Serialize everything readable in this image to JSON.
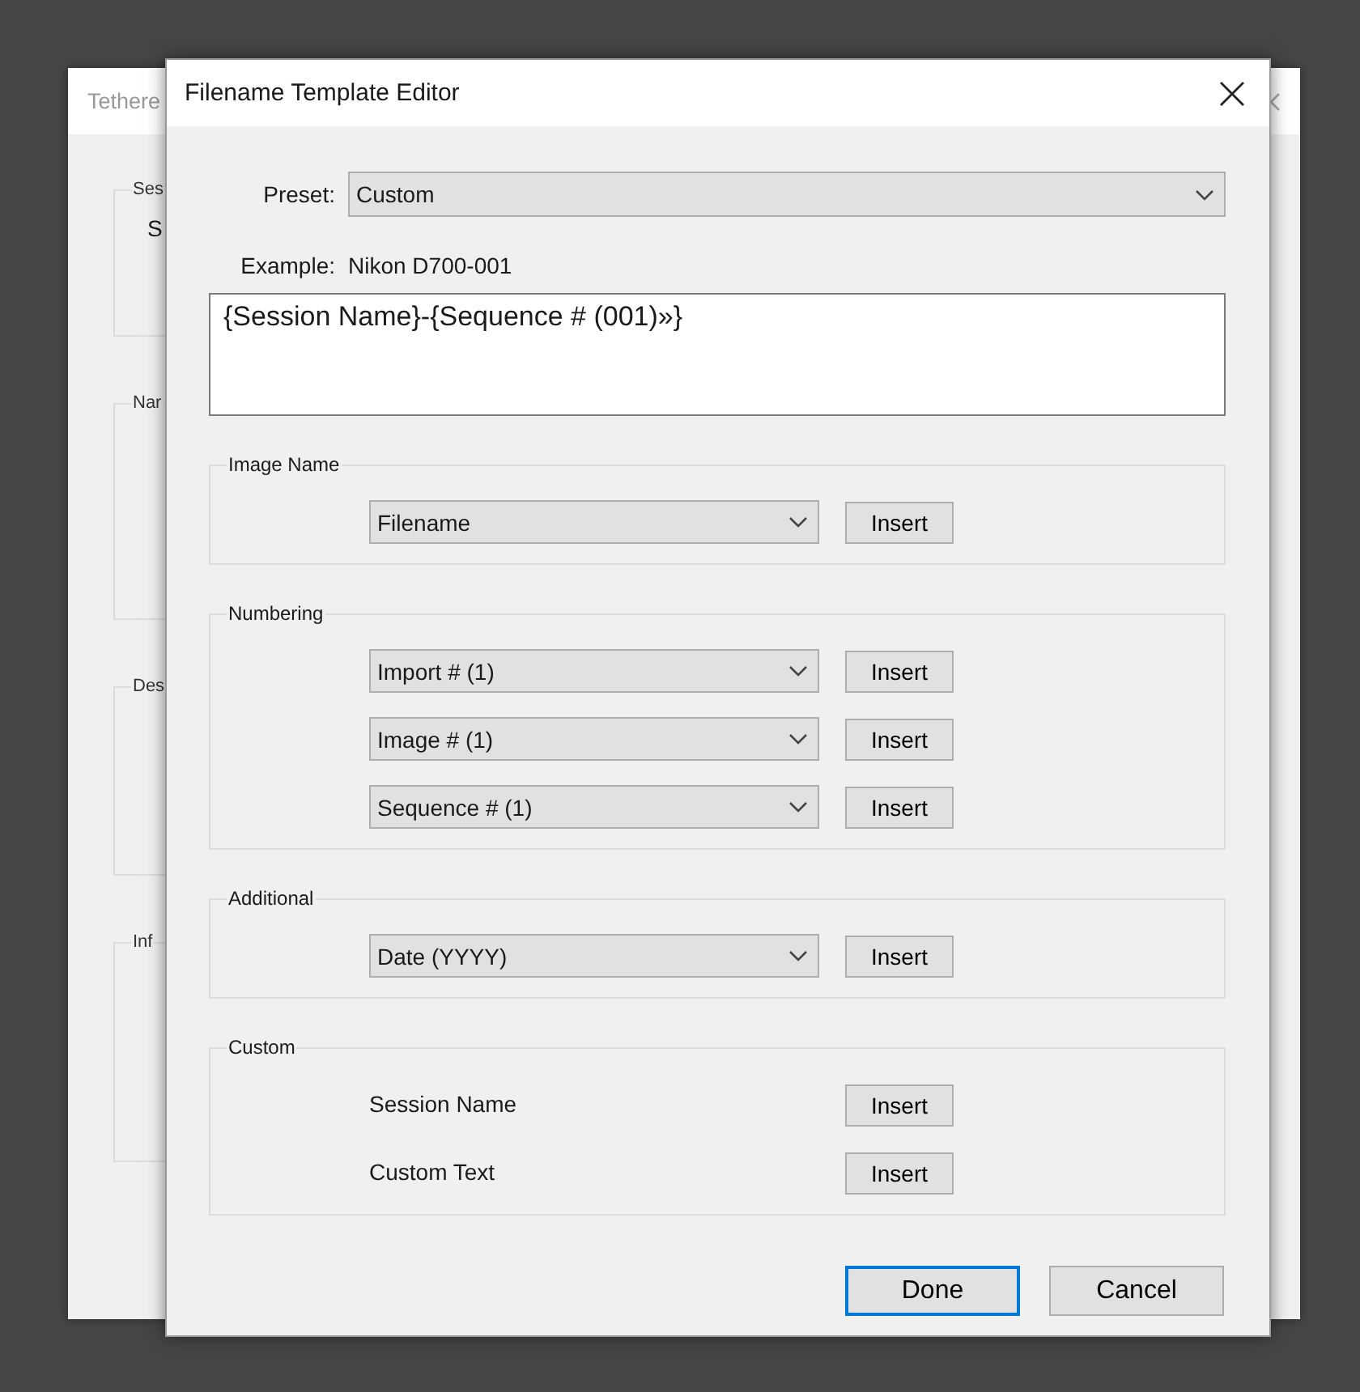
{
  "background_window": {
    "title": "Tethere",
    "groups": [
      {
        "label": "Ses",
        "text": "S"
      },
      {
        "label": "Nar"
      },
      {
        "label": "Des"
      },
      {
        "label": "Inf"
      }
    ]
  },
  "dialog": {
    "title": "Filename Template Editor",
    "preset": {
      "label": "Preset:",
      "value": "Custom"
    },
    "example": {
      "label": "Example:",
      "value": "Nikon D700-001"
    },
    "template": {
      "value": "{Session Name}-{Sequence # (001)»}"
    },
    "sections": [
      {
        "label": "Image Name",
        "rows": [
          {
            "kind": "dropdown",
            "value": "Filename",
            "button": "Insert"
          }
        ]
      },
      {
        "label": "Numbering",
        "rows": [
          {
            "kind": "dropdown",
            "value": "Import # (1)",
            "button": "Insert"
          },
          {
            "kind": "dropdown",
            "value": "Image # (1)",
            "button": "Insert"
          },
          {
            "kind": "dropdown",
            "value": "Sequence # (1)",
            "button": "Insert"
          }
        ]
      },
      {
        "label": "Additional",
        "rows": [
          {
            "kind": "dropdown",
            "value": "Date (YYYY)",
            "button": "Insert"
          }
        ]
      },
      {
        "label": "Custom",
        "rows": [
          {
            "kind": "text",
            "value": "Session Name",
            "button": "Insert"
          },
          {
            "kind": "text",
            "value": "Custom Text",
            "button": "Insert"
          }
        ]
      }
    ],
    "buttons": [
      {
        "label": "Done",
        "default": true
      },
      {
        "label": "Cancel",
        "default": false
      }
    ]
  }
}
